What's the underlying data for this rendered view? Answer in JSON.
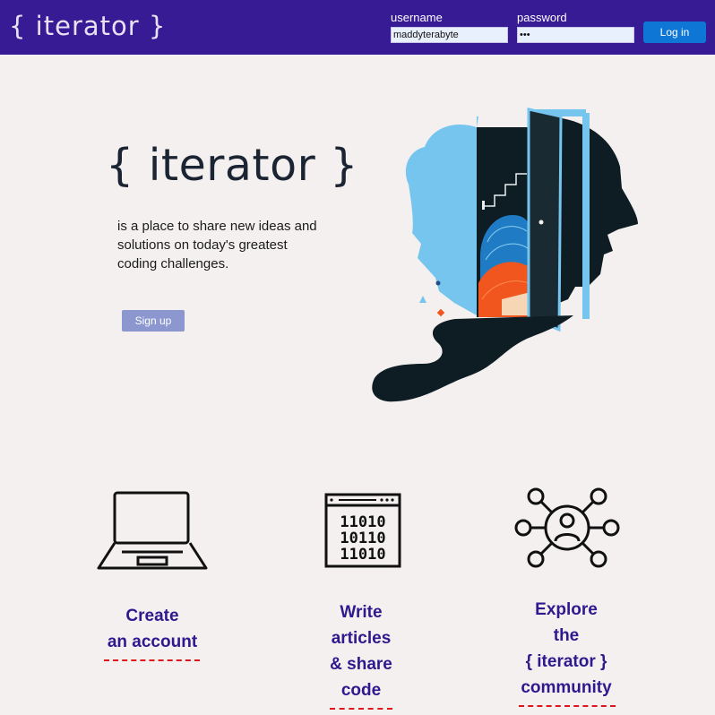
{
  "header": {
    "logo": "{ iterator }",
    "username_label": "username",
    "username_value": "maddyterabyte",
    "password_label": "password",
    "password_value": "•••",
    "login_label": "Log in"
  },
  "hero": {
    "title": "{ iterator }",
    "tagline": "is a place to share new ideas and solutions on today's greatest coding challenges.",
    "signup_label": "Sign up"
  },
  "features": [
    {
      "icon": "laptop-icon",
      "lines": [
        "Create",
        "an account"
      ]
    },
    {
      "icon": "binary-code-window-icon",
      "lines": [
        "Write",
        "articles",
        "& share",
        "code"
      ]
    },
    {
      "icon": "community-network-icon",
      "lines": [
        "Explore",
        "the",
        "{ iterator }",
        "community"
      ]
    }
  ],
  "colors": {
    "header_bg": "#371b94",
    "login_button": "#0e77d6",
    "signup_button": "#8c96cf",
    "feature_text": "#2e1a8e",
    "underline": "#e0141b",
    "page_bg": "#f3f0ef"
  }
}
